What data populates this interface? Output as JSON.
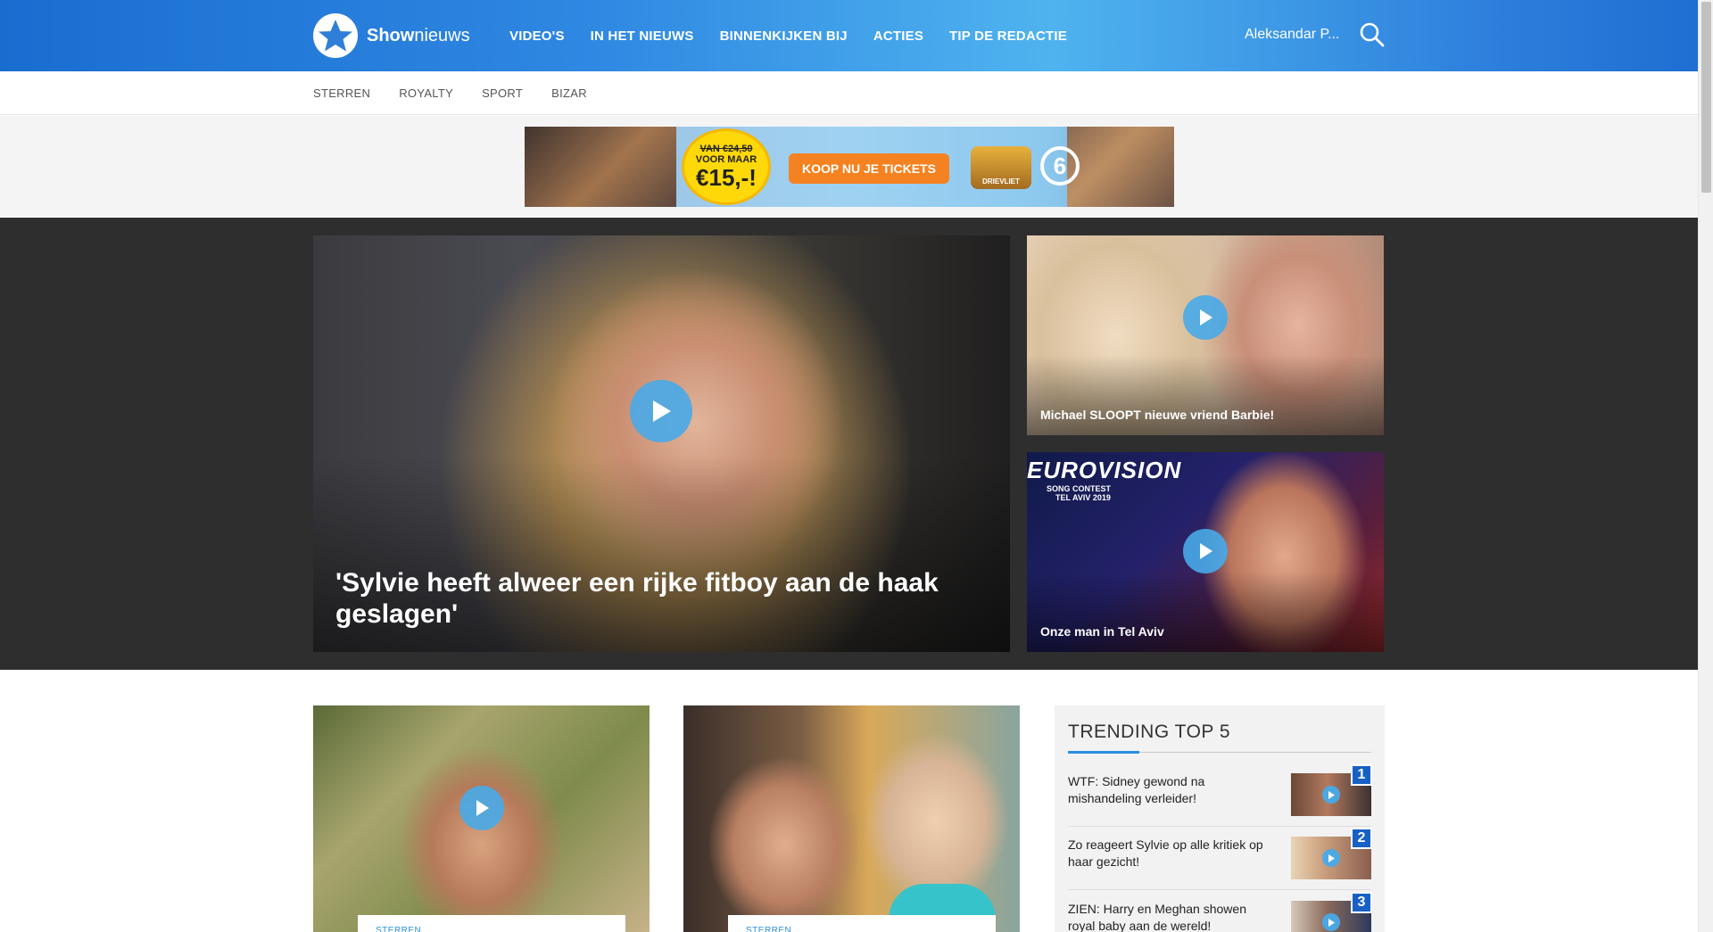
{
  "header": {
    "brand_bold": "Show",
    "brand_light": "nieuws",
    "nav": [
      "VIDEO'S",
      "IN HET NIEUWS",
      "BINNENKIJKEN BIJ",
      "ACTIES",
      "TIP DE REDACTIE"
    ],
    "user_name": "Aleksandar P...",
    "accent_color": "#2b8fe0"
  },
  "subnav": [
    "STERREN",
    "ROYALTY",
    "SPORT",
    "BIZAR"
  ],
  "ad": {
    "price_line1": "VAN €24,50",
    "price_line2": "VOOR MAAR",
    "price_big": "€15,-!",
    "cta": "KOOP NU JE TICKETS",
    "park_label": "DRIEVLIET",
    "channel": "6"
  },
  "featured": {
    "main_title": "'Sylvie heeft alweer een rijke fitboy aan de haak geslagen'",
    "side1_title": "Michael SLOOPT nieuwe vriend Barbie!",
    "side2_title": "Onze man in Tel Aviv",
    "side2_logo_main": "EUROVISION",
    "side2_logo_sub1": "SONG CONTEST",
    "side2_logo_sub2": "TEL AVIV 2019"
  },
  "cards": [
    {
      "tag": "STERREN"
    },
    {
      "tag": "STERREN"
    }
  ],
  "trending": {
    "title": "TRENDING TOP 5",
    "items": [
      {
        "rank": "1",
        "title": "WTF: Sidney gewond na mishandeling verleider!"
      },
      {
        "rank": "2",
        "title": "Zo reageert Sylvie op alle kritiek op haar gezicht!"
      },
      {
        "rank": "3",
        "title": "ZIEN: Harry en Meghan showen royal baby aan de wereld!"
      }
    ]
  }
}
